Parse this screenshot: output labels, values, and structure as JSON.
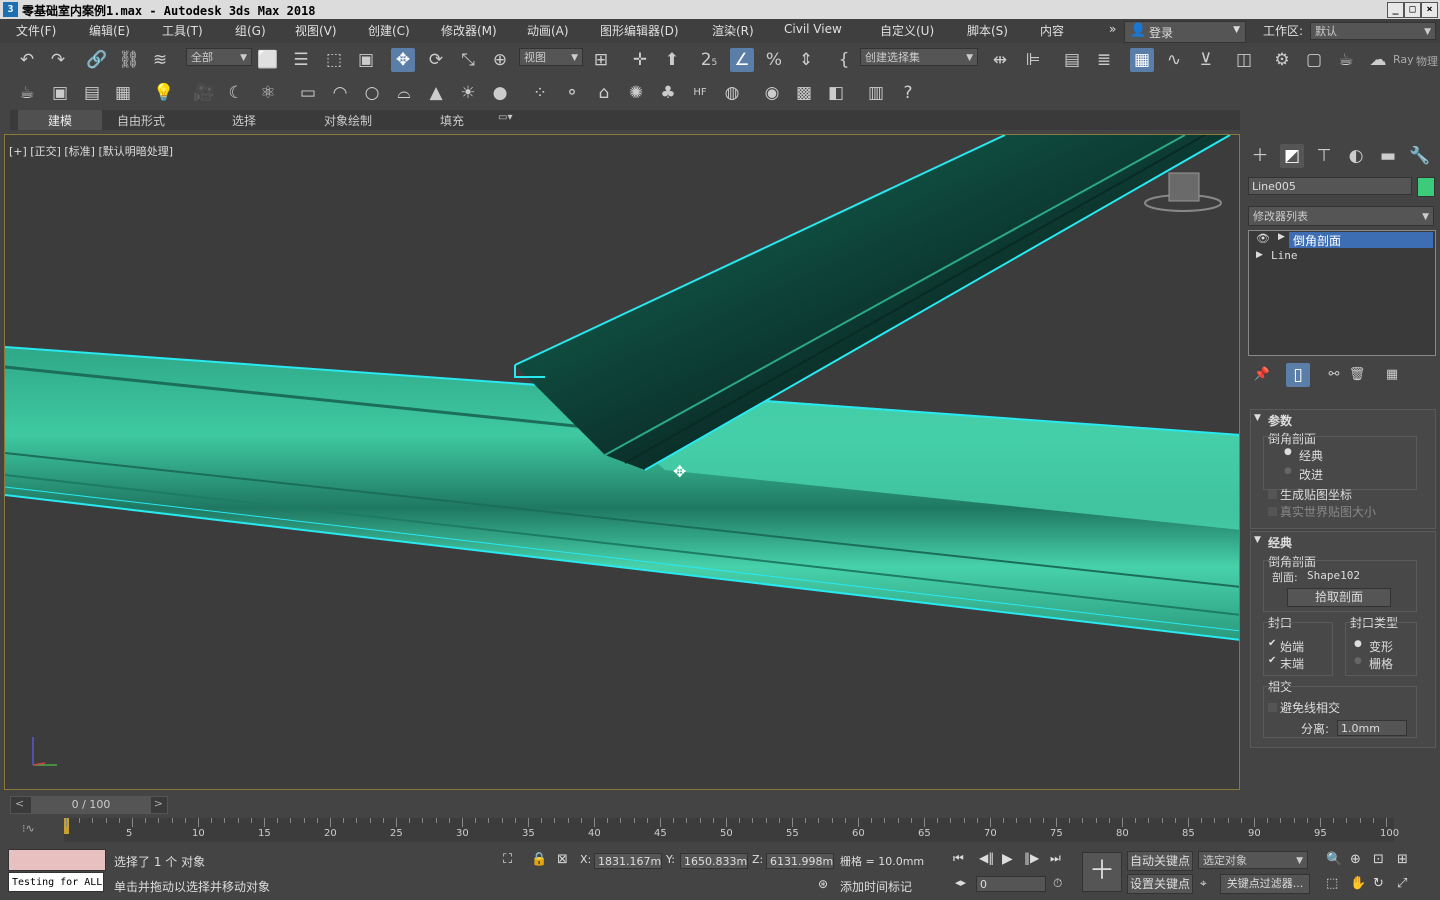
{
  "window": {
    "title": "零基础室内案例1.max  -  Autodesk 3ds Max 2018",
    "app_icon": "3",
    "controls": [
      "_",
      "□",
      "×"
    ]
  },
  "menu": {
    "items": [
      "文件(F)",
      "编辑(E)",
      "工具(T)",
      "组(G)",
      "视图(V)",
      "创建(C)",
      "修改器(M)",
      "动画(A)",
      "图形编辑器(D)",
      "渲染(R)",
      "Civil View",
      "自定义(U)",
      "脚本(S)",
      "内容"
    ],
    "overflow": "»",
    "login": "登录",
    "workspace_label": "工作区:",
    "workspace_value": "默认"
  },
  "toolbar_main": {
    "filter_value": "全部",
    "refcoord_value": "视图",
    "selection_set_placeholder": "创建选择集",
    "snap_label": "2",
    "snap_sub": "5",
    "extra_labels": [
      "Ray",
      "物理"
    ]
  },
  "ribbon": {
    "tabs": [
      "建模",
      "自由形式",
      "选择",
      "对象绘制",
      "填充"
    ],
    "active_tab": "建模"
  },
  "viewport": {
    "label": "[+] [正交] [标准] [默认明暗处理]",
    "model_color": "#3fc9a0",
    "highlight_color": "#28e8f0"
  },
  "command_panel": {
    "object_name": "Line005",
    "object_color": "#3ccb7a",
    "modifier_list_label": "修改器列表",
    "stack": [
      {
        "label": "倒角剖面",
        "selected": true
      },
      {
        "label": "Line",
        "selected": false
      }
    ],
    "params": {
      "title": "参数",
      "group_label": "倒角剖面",
      "options": [
        {
          "label": "经典",
          "checked": true
        },
        {
          "label": "改进",
          "checked": false
        }
      ],
      "gen_map_coords": "生成贴图坐标",
      "real_world_map": "真实世界贴图大小"
    },
    "classic": {
      "title": "经典",
      "group_label": "倒角剖面",
      "profile_label": "剖面:",
      "profile_value": "Shape102",
      "pick_button": "拾取剖面",
      "cap_label": "封口",
      "cap_start": "始端",
      "cap_end": "末端",
      "cap_type_label": "封口类型",
      "cap_morph": "变形",
      "cap_grid": "栅格",
      "intersect_label": "相交",
      "avoid_intersect": "避免线相交",
      "separation_label": "分离:",
      "separation_value": "1.0mm"
    }
  },
  "timeline": {
    "frame_display": "0 / 100",
    "ticks": [
      5,
      10,
      15,
      20,
      25,
      30,
      35,
      40,
      45,
      50,
      55,
      60,
      65,
      70,
      75,
      80,
      85,
      90,
      95,
      100
    ]
  },
  "status": {
    "script_listener": "Testing for ALL",
    "selected_text": "选择了 1 个 对象",
    "prompt_text": "单击并拖动以选择并移动对象",
    "x_label": "X:",
    "x_value": "1831.167m",
    "y_label": "Y:",
    "y_value": "1650.833m",
    "z_label": "Z:",
    "z_value": "6131.998m",
    "grid_label": "栅格 = 10.0mm",
    "add_time_tag": "添加时间标记",
    "auto_key": "自动关键点",
    "set_key": "设置关键点",
    "key_filter_dropdown": "选定对象",
    "key_filters": "关键点过滤器...",
    "current_frame": "0"
  }
}
